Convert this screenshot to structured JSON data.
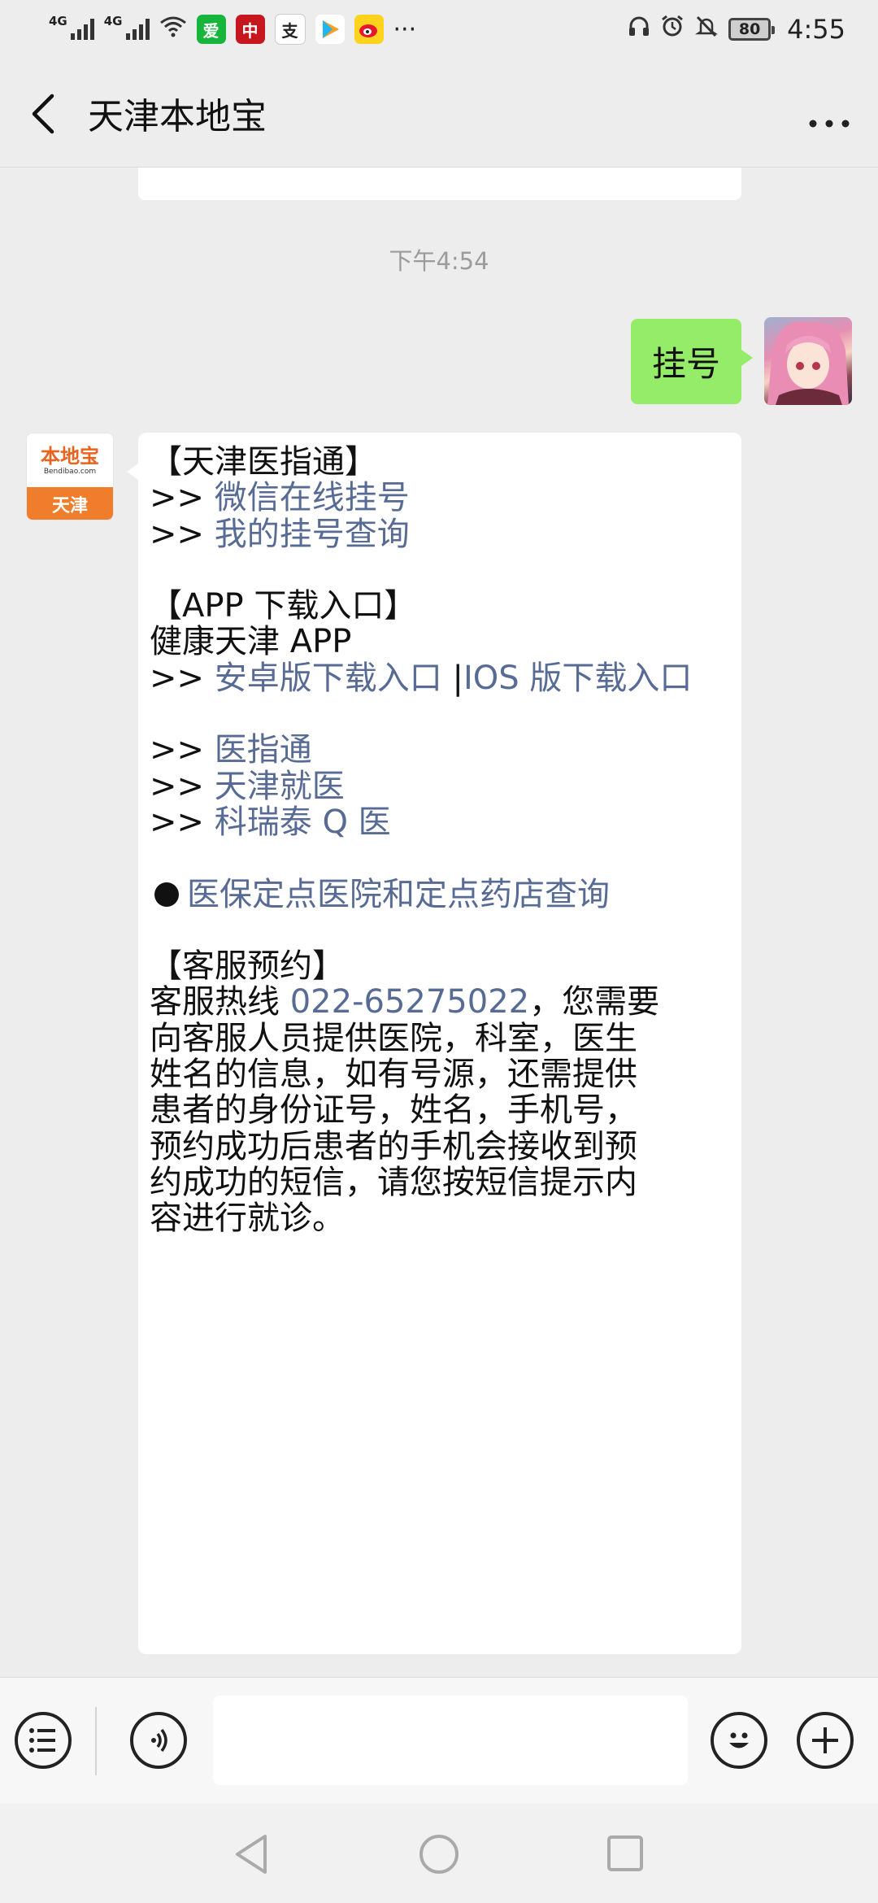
{
  "status_bar": {
    "network1": "4G",
    "network2": "4G",
    "apps": [
      "iqiyi-icon",
      "bank-of-china-icon",
      "alipay-icon",
      "tencent-video-icon",
      "weibo-icon"
    ],
    "more": "···",
    "battery": "80",
    "time": "4:55"
  },
  "header": {
    "title": "天津本地宝"
  },
  "chat": {
    "timestamp": "下午4:54",
    "outgoing": "挂号",
    "bot_avatar": {
      "brand": "本地宝",
      "domain": "Bendibao.com",
      "city": "天津"
    },
    "reply": {
      "section1_title": "【天津医指通】",
      "prefix": ">>",
      "link_wechat_register": "微信在线挂号",
      "link_my_register": "我的挂号查询",
      "section2_title": "【APP 下载入口】",
      "app_name": "健康天津 APP",
      "link_android": "安卓版下载入口",
      "separator": "|",
      "link_ios": "IOS 版下载入口",
      "link_yizhitong": "医指通",
      "link_tianjin_jiuyi": "天津就医",
      "link_keruitai": "科瑞泰 Q 医",
      "link_yibao": "医保定点医院和定点药店查询",
      "section3_title": "【客服预约】",
      "hotline_label": "客服热线 ",
      "hotline_number": "022-65275022",
      "hotline_text_1": "，您需要",
      "line_2": "向客服人员提供医院，科室，医生",
      "line_3": "姓名的信息，如有号源，还需提供",
      "line_4": "患者的身份证号，姓名，手机号，",
      "line_5": "预约成功后患者的手机会接收到预",
      "line_6": "约成功的短信，请您按短信提示内",
      "line_7": "容进行就诊。"
    }
  },
  "input": {
    "value": "",
    "placeholder": ""
  },
  "colors": {
    "outgoing_bubble": "#95ec69",
    "link": "#576b95",
    "background": "#ededed",
    "brand_orange": "#f07d2c"
  }
}
